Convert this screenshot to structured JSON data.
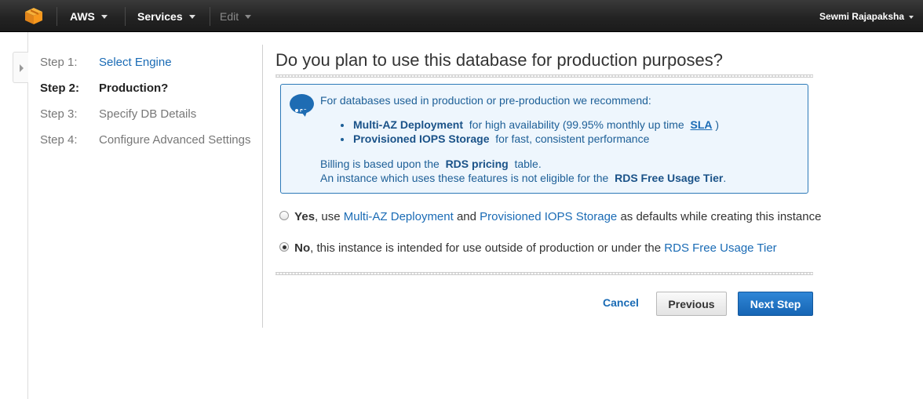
{
  "topnav": {
    "brand": "AWS",
    "services": "Services",
    "edit": "Edit",
    "user": "Sewmi Rajapaksha"
  },
  "steps": [
    {
      "num": "Step 1:",
      "label": "Select Engine",
      "state": "link"
    },
    {
      "num": "Step 2:",
      "label": "Production?",
      "state": "current"
    },
    {
      "num": "Step 3:",
      "label": "Specify DB Details",
      "state": "pending"
    },
    {
      "num": "Step 4:",
      "label": "Configure Advanced Settings",
      "state": "pending"
    }
  ],
  "main": {
    "title": "Do you plan to use this database for production purposes?",
    "info": {
      "intro": "For databases used in production or pre-production we recommend:",
      "bullet1_strong": "Multi-AZ Deployment",
      "bullet1_text": "for high availability (99.95% monthly up time",
      "bullet1_link": "SLA",
      "bullet1_close": ")",
      "bullet2_strong": "Provisioned IOPS Storage",
      "bullet2_text": "for fast, consistent performance",
      "billing_pre": "Billing is based upon the",
      "billing_strong": "RDS pricing",
      "billing_post": "table.",
      "tier_pre": "An instance which uses these features is not eligible for the",
      "tier_strong": "RDS Free Usage Tier",
      "tier_post": "."
    },
    "options": {
      "yes_label": "Yes",
      "yes_use": ", use",
      "yes_link1": "Multi-AZ Deployment",
      "yes_and": "and",
      "yes_link2": "Provisioned IOPS Storage",
      "yes_rest": "as defaults while creating this instance",
      "no_label": "No",
      "no_rest": ", this instance is intended for use outside of production or under the",
      "no_link": "RDS Free Usage Tier",
      "selected": "No"
    },
    "buttons": {
      "cancel": "Cancel",
      "previous": "Previous",
      "next": "Next Step"
    }
  },
  "colors": {
    "accent": "#1a6bb5",
    "nav_bg": "#232323",
    "info_bg": "#eef6fd",
    "info_border": "#2d7ab8",
    "logo_orange": "#f7981d"
  }
}
